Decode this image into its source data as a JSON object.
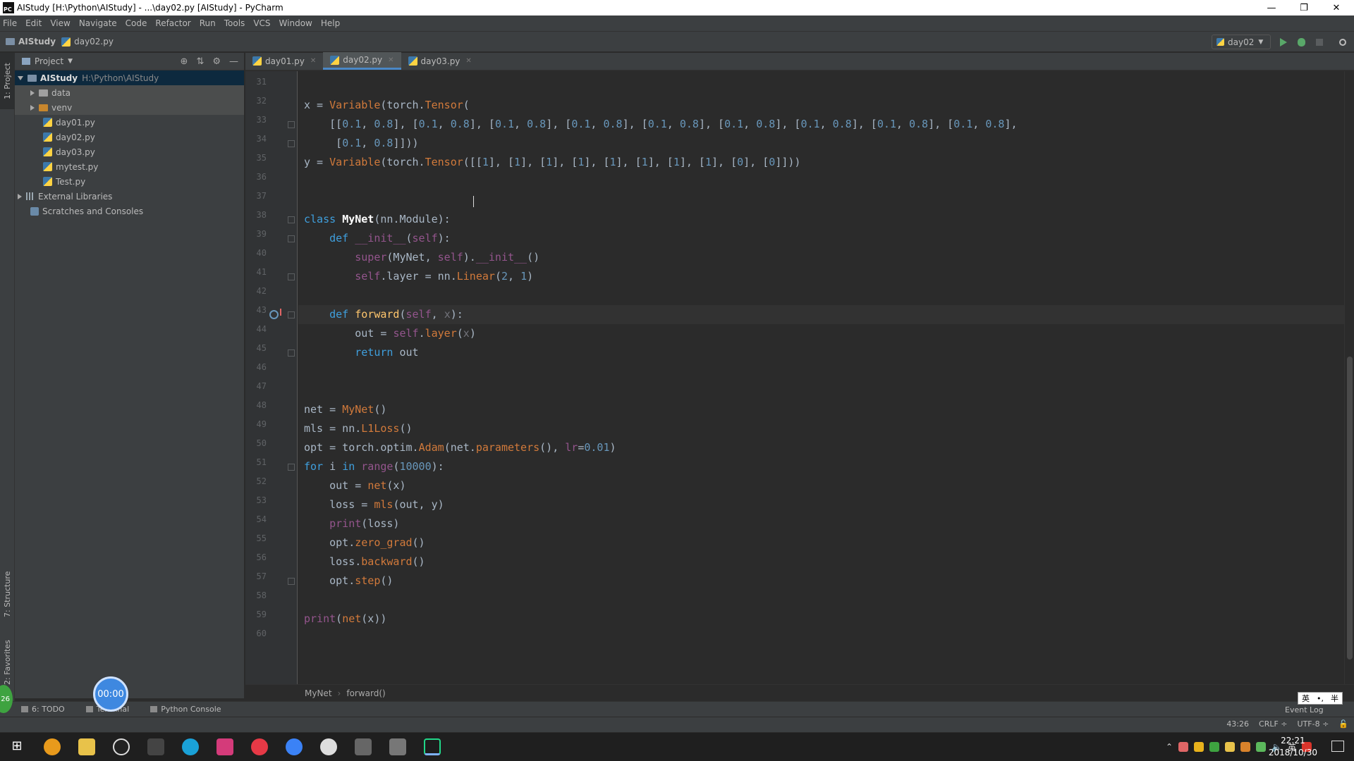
{
  "window": {
    "title": "AIStudy [H:\\Python\\AIStudy] - ...\\day02.py [AIStudy] - PyCharm",
    "app_icon_text": "PC"
  },
  "menu": [
    "File",
    "Edit",
    "View",
    "Navigate",
    "Code",
    "Refactor",
    "Run",
    "Tools",
    "VCS",
    "Window",
    "Help"
  ],
  "navbar": {
    "project": "AIStudy",
    "file": "day02.py",
    "run_config": "day02"
  },
  "project_panel": {
    "header": "Project",
    "root_name": "AIStudy",
    "root_path": "H:\\Python\\AIStudy",
    "items": [
      {
        "label": "data",
        "type": "folder"
      },
      {
        "label": "venv",
        "type": "folder"
      },
      {
        "label": "day01.py",
        "type": "file"
      },
      {
        "label": "day02.py",
        "type": "file"
      },
      {
        "label": "day03.py",
        "type": "file"
      },
      {
        "label": "mytest.py",
        "type": "file"
      },
      {
        "label": "Test.py",
        "type": "file"
      }
    ],
    "external_libraries": "External Libraries",
    "scratches": "Scratches and Consoles"
  },
  "left_strip": {
    "project_tab": "1: Project",
    "structure_tab": "7: Structure",
    "favorites_tab": "2: Favorites"
  },
  "tabs": [
    {
      "label": "day01.py",
      "active": false
    },
    {
      "label": "day02.py",
      "active": true
    },
    {
      "label": "day03.py",
      "active": false
    }
  ],
  "editor": {
    "line_numbers": [
      "31",
      "32",
      "33",
      "34",
      "35",
      "36",
      "37",
      "38",
      "39",
      "40",
      "41",
      "42",
      "43",
      "44",
      "45",
      "46",
      "47",
      "48",
      "49",
      "50",
      "51",
      "52",
      "53",
      "54",
      "55",
      "56",
      "57",
      "58",
      "59",
      "60"
    ],
    "current_line": "43"
  },
  "breadcrumb": [
    "MyNet",
    "forward()"
  ],
  "bottom_tools": [
    "6: TODO",
    "Terminal",
    "Python Console"
  ],
  "status": {
    "position": "43:26",
    "line_sep": "CRLF ÷",
    "encoding": "UTF-8 ÷",
    "event_log": "Event Log"
  },
  "overlay": {
    "timer": "00:00",
    "side_badge": "26",
    "ime": [
      "英",
      "•,",
      "半"
    ]
  },
  "taskbar": {
    "time": "22:21",
    "date": "2018/10/30",
    "ime_lang": "英"
  },
  "colors": {
    "editor_bg": "#2b2b2b",
    "panel_bg": "#3c3f41",
    "keyword": "#cc7832",
    "number": "#6897bb",
    "function": "#ffc66d",
    "selection": "#0d293e",
    "accent": "#4a88c7"
  }
}
